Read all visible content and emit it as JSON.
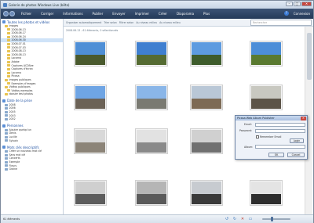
{
  "window": {
    "title": "Galerie de photos Windows Live (bêta)",
    "minimize": "–",
    "maximize": "□",
    "close": "✕"
  },
  "menu": {
    "items": [
      "Fichier",
      "Corriger",
      "Informations",
      "Publier",
      "Envoyer",
      "Imprimer",
      "Créer",
      "Diaporama",
      "Plus"
    ],
    "help": "?",
    "connexion": "Connexion"
  },
  "searchbar": {
    "breadcrumbs": [
      "Organiser automatiquement",
      "Trier selon",
      "Filtrer selon",
      "Au niveau milieu",
      "Au niveau milieu"
    ],
    "placeholder": "Rechercher"
  },
  "content_header": "2008.06.13 - 61 éléments, 0 sélectionnés",
  "sidebar": {
    "sections": [
      {
        "title": "Toutes les photos et vidéos",
        "items": [
          {
            "label": "Images",
            "indent": 1,
            "type": "folder"
          },
          {
            "label": "2008.06.13",
            "indent": 2,
            "type": "folder"
          },
          {
            "label": "2008.06.17",
            "indent": 2,
            "type": "folder"
          },
          {
            "label": "2008.06.24",
            "indent": 2,
            "type": "folder"
          },
          {
            "label": "2008.06.30",
            "indent": 2,
            "type": "folder",
            "selected": true
          },
          {
            "label": "2008.07.01",
            "indent": 2,
            "type": "folder"
          },
          {
            "label": "2008.07.03",
            "indent": 2,
            "type": "folder"
          },
          {
            "label": "2008.08.13",
            "indent": 2,
            "type": "folder"
          },
          {
            "label": "2008.08.13",
            "indent": 2,
            "type": "folder"
          },
          {
            "label": "Locarno",
            "indent": 2,
            "type": "folder"
          },
          {
            "label": "Adobe",
            "indent": 2,
            "type": "folder"
          },
          {
            "label": "Captures ACDSee",
            "indent": 2,
            "type": "folder"
          },
          {
            "label": "Captures d'écran",
            "indent": 2,
            "type": "folder"
          },
          {
            "label": "Locarno",
            "indent": 2,
            "type": "folder"
          },
          {
            "label": "Picasa",
            "indent": 2,
            "type": "folder"
          },
          {
            "label": "Images publiques",
            "indent": 1,
            "type": "folder"
          },
          {
            "label": "Exemples d'images",
            "indent": 2,
            "type": "folder"
          },
          {
            "label": "Vidéos publiques",
            "indent": 1,
            "type": "folder"
          },
          {
            "label": "Vidéos exemples",
            "indent": 2,
            "type": "folder"
          },
          {
            "label": "dossier test photos",
            "indent": 1,
            "type": "folder"
          }
        ]
      },
      {
        "title": "Date de la prise",
        "items": [
          {
            "label": "2008",
            "indent": 1,
            "type": "pic"
          },
          {
            "label": "2006",
            "indent": 1,
            "type": "pic"
          },
          {
            "label": "2005",
            "indent": 1,
            "type": "pic"
          },
          {
            "label": "2003",
            "indent": 1,
            "type": "pic"
          },
          {
            "label": "2002",
            "indent": 1,
            "type": "pic"
          }
        ]
      },
      {
        "title": "Personnes",
        "items": [
          {
            "label": "Ajouter quelqu'un",
            "indent": 1,
            "type": "pic"
          },
          {
            "label": "Denis",
            "indent": 1,
            "type": "pic"
          },
          {
            "label": "Lucille",
            "indent": 1,
            "type": "pic"
          },
          {
            "label": "Sylvain",
            "indent": 1,
            "type": "pic"
          }
        ]
      },
      {
        "title": "Mots clés descriptifs",
        "items": [
          {
            "label": "Créer un nouveau mot clé",
            "indent": 1,
            "type": "pic"
          },
          {
            "label": "Sans mot clé",
            "indent": 1,
            "type": "pic"
          },
          {
            "label": "Concerts",
            "indent": 1,
            "type": "pic"
          },
          {
            "label": "Exemple",
            "indent": 1,
            "type": "pic"
          },
          {
            "label": "Fleurs",
            "indent": 1,
            "type": "pic"
          },
          {
            "label": "Graine",
            "indent": 1,
            "type": "pic"
          }
        ]
      }
    ]
  },
  "thumbnails": [
    {
      "name": "canal-photo-1",
      "sky": "#4f8fd6",
      "ground": "#4a5a2e"
    },
    {
      "name": "canal-photo-2",
      "sky": "#3f7fd0",
      "ground": "#556b32"
    },
    {
      "name": "house-photo-1",
      "sky": "#5d9be0",
      "ground": "#3e5c2c"
    },
    {
      "name": "park-photo-1",
      "sky": "#4d8ed8",
      "ground": "#5a7a30"
    },
    {
      "name": "church-photo-1",
      "sky": "#6fa5e4",
      "ground": "#6b6256"
    },
    {
      "name": "building-photo-1",
      "sky": "#8ab6e8",
      "ground": "#7a7a72"
    },
    {
      "name": "palace-photo-1",
      "sky": "#b9c7d6",
      "ground": "#7d6a55"
    },
    {
      "name": "arcade-photo-1",
      "sky": "#c8c8c0",
      "ground": "#5c5448"
    },
    {
      "name": "obelisk-photo-1",
      "sky": "#d8d8d8",
      "ground": "#8c8478"
    },
    {
      "name": "graffiti-photo-1",
      "sky": "#e2e2e2",
      "ground": "#8a8a8a"
    },
    {
      "name": "graffiti-photo-2",
      "sky": "#d0d0d0",
      "ground": "#707070"
    },
    {
      "name": "interior-photo-1",
      "sky": "#9a8f84",
      "ground": "#4a4038"
    },
    {
      "name": "tunnel-photo-1",
      "sky": "#cfcfcf",
      "ground": "#5d5d5d"
    },
    {
      "name": "stairs-photo-1",
      "sky": "#b5b5b5",
      "ground": "#5a5a5a"
    },
    {
      "name": "street-photo-1",
      "sky": "#c7cbd0",
      "ground": "#3a3a3a"
    },
    {
      "name": "traffic-light-photo-1",
      "sky": "#e4e4e4",
      "ground": "#2e2e2e"
    },
    {
      "name": "traffic-light-photo-2",
      "sky": "#e6e6e6",
      "ground": "#333333"
    }
  ],
  "dialog": {
    "title": "Picasa Web Album Publisher",
    "email_label": "Email:",
    "password_label": "Password:",
    "remember_label": "Remember Email",
    "login_button": "Login",
    "album_label": "Album:",
    "ok_button": "OK",
    "cancel_button": "Cancel"
  },
  "status": {
    "count": "61 éléments"
  }
}
